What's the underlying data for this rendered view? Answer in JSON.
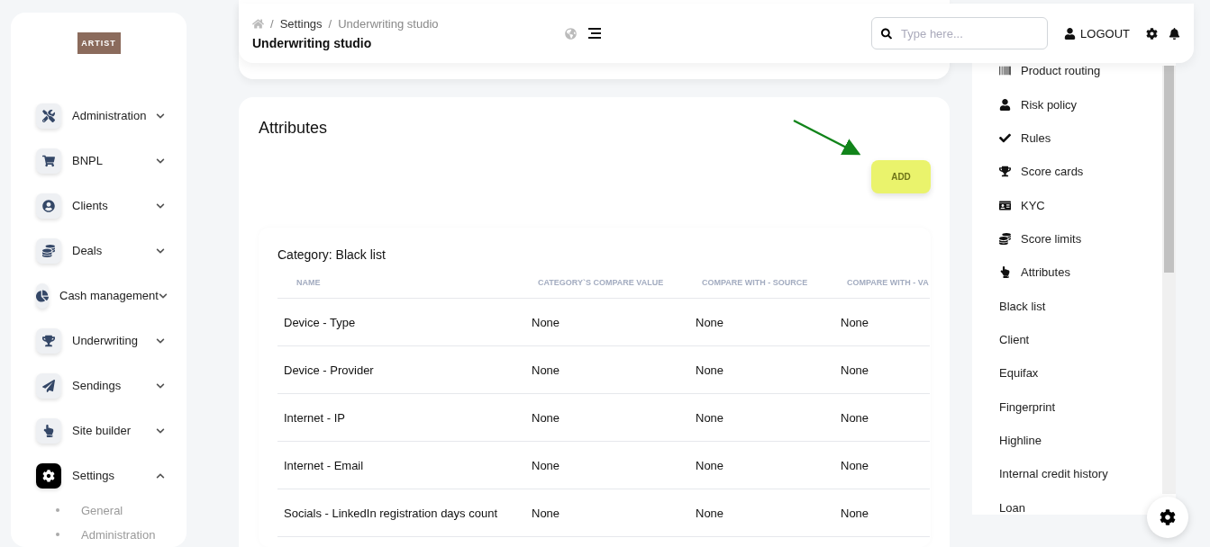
{
  "logo": {
    "text": "ARTIST"
  },
  "sidebar": {
    "items": [
      {
        "label": "Administration",
        "selected": false,
        "expanded": false
      },
      {
        "label": "BNPL",
        "selected": false,
        "expanded": false
      },
      {
        "label": "Clients",
        "selected": false,
        "expanded": false
      },
      {
        "label": "Deals",
        "selected": false,
        "expanded": false
      },
      {
        "label": "Cash management",
        "selected": false,
        "expanded": false
      },
      {
        "label": "Underwriting",
        "selected": false,
        "expanded": false
      },
      {
        "label": "Sendings",
        "selected": false,
        "expanded": false
      },
      {
        "label": "Site builder",
        "selected": false,
        "expanded": false
      },
      {
        "label": "Settings",
        "selected": true,
        "expanded": true,
        "children": [
          {
            "label": "General"
          },
          {
            "label": "Administration"
          }
        ]
      }
    ]
  },
  "header": {
    "separator": "/",
    "breadcrumb": [
      "Settings",
      "Underwriting studio"
    ],
    "title": "Underwriting studio",
    "search": {
      "placeholder": "Type here..."
    },
    "logout": "LOGOUT"
  },
  "attributes": {
    "title": "Attributes",
    "add_button": "ADD",
    "category": "Category: Black list",
    "table": {
      "columns": [
        "NAME",
        "CATEGORY`S COMPARE VALUE",
        "COMPARE WITH - SOURCE",
        "COMPARE WITH - VA"
      ],
      "rows": [
        [
          "Device - Type",
          "None",
          "None",
          "None"
        ],
        [
          "Device - Provider",
          "None",
          "None",
          "None"
        ],
        [
          "Internet - IP",
          "None",
          "None",
          "None"
        ],
        [
          "Internet - Email",
          "None",
          "None",
          "None"
        ],
        [
          "Socials - LinkedIn registration days count",
          "None",
          "None",
          "None"
        ]
      ]
    }
  },
  "right_panel": {
    "items": [
      {
        "label": "Product routing",
        "kind": "icon"
      },
      {
        "label": "Risk policy",
        "kind": "icon"
      },
      {
        "label": "Rules",
        "kind": "icon"
      },
      {
        "label": "Score cards",
        "kind": "icon"
      },
      {
        "label": "KYC",
        "kind": "icon"
      },
      {
        "label": "Score limits",
        "kind": "icon"
      },
      {
        "label": "Attributes",
        "kind": "icon"
      },
      {
        "label": "Black list",
        "kind": "plain"
      },
      {
        "label": "Client",
        "kind": "plain"
      },
      {
        "label": "Equifax",
        "kind": "plain"
      },
      {
        "label": "Fingerprint",
        "kind": "plain"
      },
      {
        "label": "Highline",
        "kind": "plain"
      },
      {
        "label": "Internal credit history",
        "kind": "plain"
      },
      {
        "label": "Loan",
        "kind": "plain"
      }
    ]
  }
}
